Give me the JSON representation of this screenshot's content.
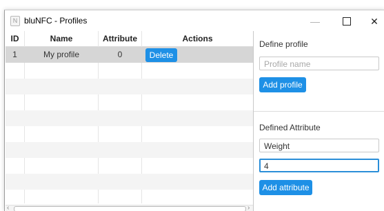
{
  "window": {
    "title": "bluNFC - Profiles",
    "app_icon": "N",
    "controls": {
      "minimize": "—",
      "maximize": "max-icon",
      "close": "✕"
    }
  },
  "table": {
    "columns": [
      "ID",
      "Name",
      "Attribute",
      "Actions"
    ],
    "rows": [
      {
        "id": "1",
        "name": "My profile",
        "attribute": "0",
        "action": "Delete"
      }
    ],
    "empty_rows": 10
  },
  "define_profile": {
    "label": "Define profile",
    "name_placeholder": "Profile name",
    "name_value": "",
    "add_button": "Add profile"
  },
  "defined_attribute": {
    "label": "Defined Attribute",
    "attribute_value": "Weight",
    "amount_value": "4",
    "add_button": "Add attribute"
  },
  "scroll": {
    "left": "‹",
    "right": "›"
  },
  "colors": {
    "accent": "#1e90e6",
    "selected_row": "#d6d6d6",
    "focus_border": "#2a8ed8"
  }
}
